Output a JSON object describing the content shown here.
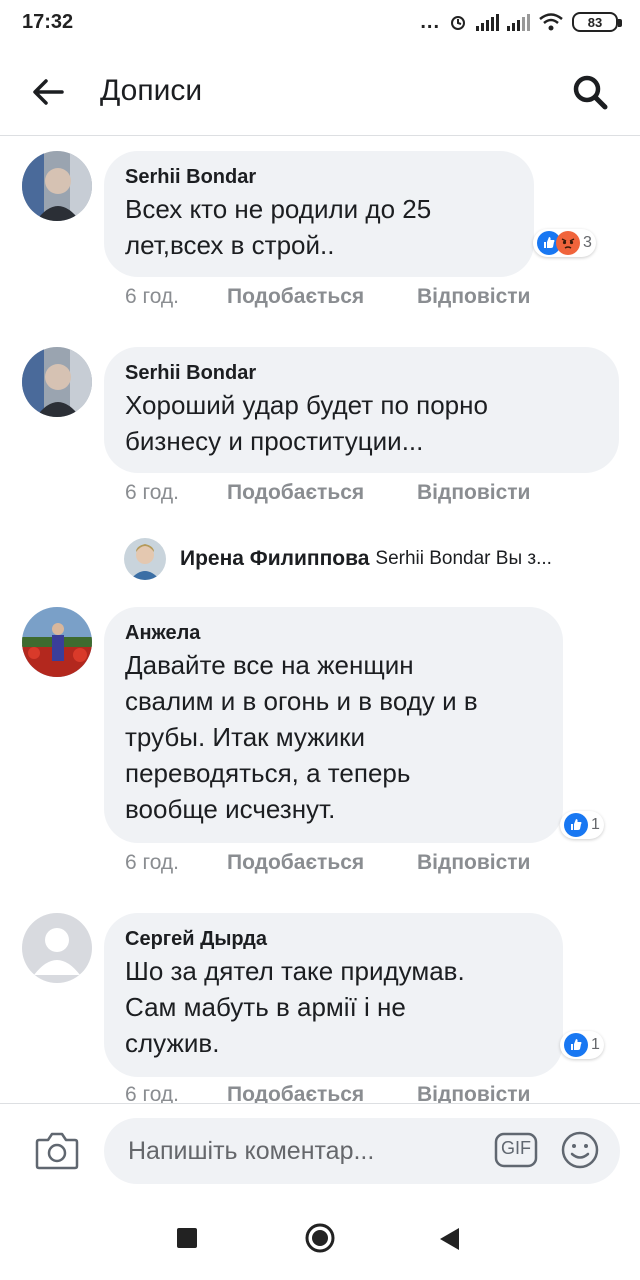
{
  "status_bar": {
    "time": "17:32",
    "battery": "83",
    "dots": "..."
  },
  "header": {
    "title": "Дописи",
    "back_icon": "arrow-left-icon",
    "search_icon": "search-icon"
  },
  "comments": [
    {
      "author": "Serhii Bondar",
      "text_lines": [
        "Всех кто не родили до 25",
        "лет,всех в строй.."
      ],
      "time": "6 год.",
      "like_label": "Подобається",
      "reply_label": "Відповісти",
      "reactions": [
        "like",
        "angry"
      ],
      "reaction_count": "3"
    },
    {
      "author": "Serhii Bondar",
      "text_lines": [
        "Хороший удар будет по порно",
        "бизнесу и проституции..."
      ],
      "time": "6 год.",
      "like_label": "Подобається",
      "reply_label": "Відповісти"
    },
    {
      "author": "Анжела",
      "text_lines": [
        "Давайте все на женщин",
        "свалим и в огонь и в воду и в",
        "трубы. Итак мужики",
        "переводяться, а теперь",
        "вообще исчезнут."
      ],
      "time": "6 год.",
      "like_label": "Подобається",
      "reply_label": "Відповісти",
      "reactions": [
        "like"
      ],
      "reaction_count": "1"
    },
    {
      "author": "Сергей Дырда",
      "text_lines": [
        "Шо за дятел таке придумав.",
        "Сам мабуть в армії і не",
        "служив."
      ],
      "time": "6 год.",
      "like_label": "Подобається",
      "reply_label": "Відповісти",
      "reactions": [
        "like"
      ],
      "reaction_count": "1"
    }
  ],
  "reply_preview": {
    "name": "Ирена Филиппова",
    "snippet": "Serhii Bondar Вы з..."
  },
  "composer": {
    "placeholder": "Напишіть коментар...",
    "gif_label": "GIF",
    "camera_icon": "camera-icon",
    "emoji_icon": "emoji-icon"
  },
  "colors": {
    "bubble": "#f0f2f5",
    "like_blue": "#1877f2",
    "angry_orange": "#f0643c",
    "meta_gray": "#8a8d91"
  }
}
